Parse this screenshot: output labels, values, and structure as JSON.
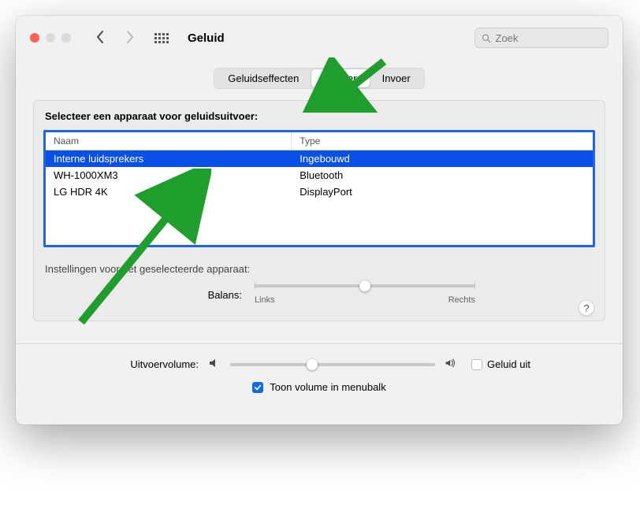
{
  "titlebar": {
    "title": "Geluid",
    "search_placeholder": "Zoek"
  },
  "tabs": {
    "sound_effects": "Geluidseffecten",
    "output": "Uitvoer",
    "input": "Invoer"
  },
  "panel": {
    "select_device_label": "Selecteer een apparaat voor geluidsuitvoer:",
    "col_name": "Naam",
    "col_type": "Type",
    "devices": [
      {
        "name": "Interne luidsprekers",
        "type": "Ingebouwd"
      },
      {
        "name": "WH-1000XM3",
        "type": "Bluetooth"
      },
      {
        "name": "LG HDR 4K",
        "type": "DisplayPort"
      }
    ],
    "settings_label": "Instellingen voor het geselecteerde apparaat:",
    "balance_label": "Balans:",
    "balance_left": "Links",
    "balance_right": "Rechts"
  },
  "footer": {
    "volume_label": "Uitvoervolume:",
    "mute_label": "Geluid uit",
    "show_in_menubar": "Toon volume in menubalk"
  },
  "help_tooltip": "?"
}
